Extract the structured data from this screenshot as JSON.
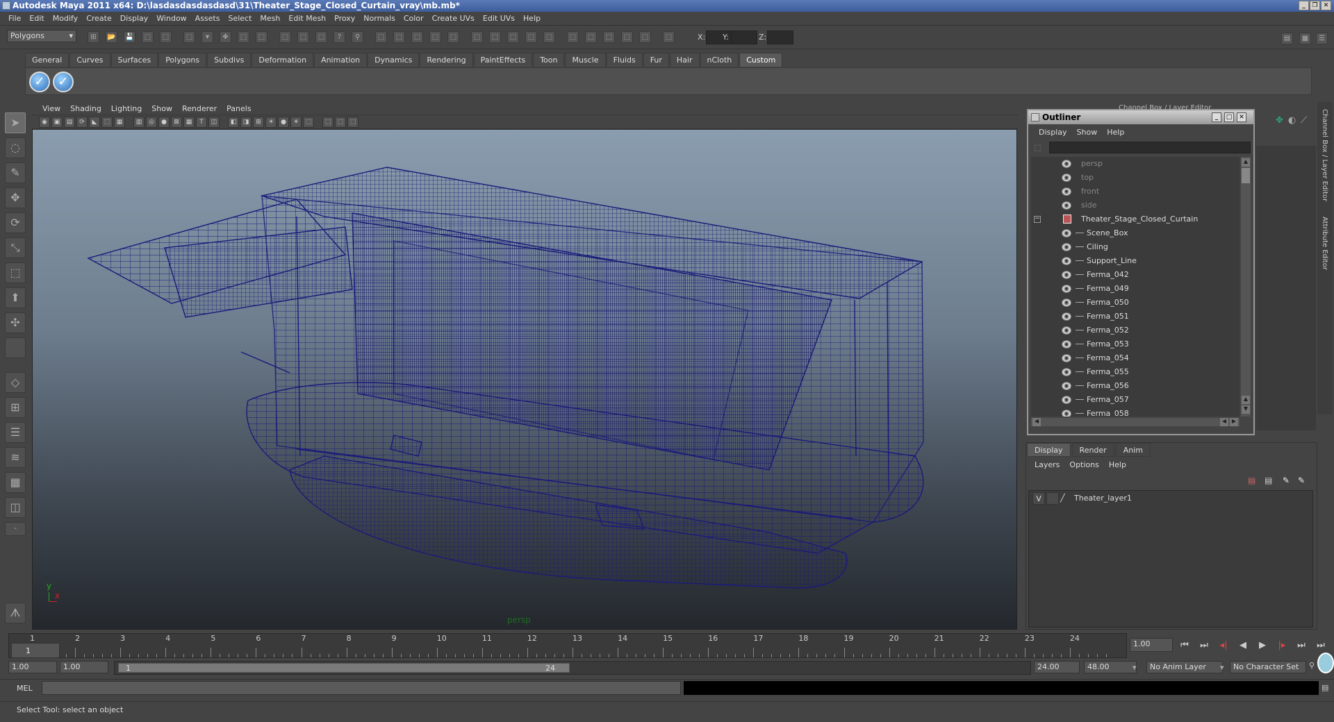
{
  "window": {
    "title": "Autodesk Maya 2011 x64: D:\\lasdasdasdasdasd\\31\\Theater_Stage_Closed_Curtain_vray\\mb.mb*"
  },
  "menubar": [
    "File",
    "Edit",
    "Modify",
    "Create",
    "Display",
    "Window",
    "Assets",
    "Select",
    "Mesh",
    "Edit Mesh",
    "Proxy",
    "Normals",
    "Color",
    "Create UVs",
    "Edit UVs",
    "Help"
  ],
  "status_line": {
    "mode": "Polygons",
    "x_label": "X:",
    "y_label": "Y:",
    "z_label": "Z:"
  },
  "shelf": {
    "tabs": [
      "General",
      "Curves",
      "Surfaces",
      "Polygons",
      "Subdivs",
      "Deformation",
      "Animation",
      "Dynamics",
      "Rendering",
      "PaintEffects",
      "Toon",
      "Muscle",
      "Fluids",
      "Fur",
      "Hair",
      "nCloth",
      "Custom"
    ],
    "active_tab": "Custom"
  },
  "viewport": {
    "menu": [
      "View",
      "Shading",
      "Lighting",
      "Show",
      "Renderer",
      "Panels"
    ],
    "camera": "persp",
    "axis_y": "y",
    "axis_x": "x",
    "wire_color": "#1a1a7a"
  },
  "outliner": {
    "title": "Outliner",
    "menu": [
      "Display",
      "Show",
      "Help"
    ],
    "cameras": [
      "persp",
      "top",
      "front",
      "side"
    ],
    "root": "Theater_Stage_Closed_Curtain",
    "children": [
      "Scene_Box",
      "Ciling",
      "Support_Line",
      "Ferma_042",
      "Ferma_049",
      "Ferma_050",
      "Ferma_051",
      "Ferma_052",
      "Ferma_053",
      "Ferma_054",
      "Ferma_055",
      "Ferma_056",
      "Ferma_057",
      "Ferma_058"
    ]
  },
  "channel_box": {
    "header": "Channel Box / Layer Editor",
    "side_tab_1": "Channel Box / Layer Editor",
    "side_tab_2": "Attribute Editor"
  },
  "layer_editor": {
    "tabs": [
      "Display",
      "Render",
      "Anim"
    ],
    "active_tab": "Display",
    "menu": [
      "Layers",
      "Options",
      "Help"
    ],
    "layer": {
      "visible": "V",
      "name": "Theater_layer1"
    }
  },
  "time_slider": {
    "ticks": [
      "1",
      "2",
      "3",
      "4",
      "5",
      "6",
      "7",
      "8",
      "9",
      "10",
      "11",
      "12",
      "13",
      "14",
      "15",
      "16",
      "17",
      "18",
      "19",
      "20",
      "21",
      "22",
      "23",
      "24"
    ],
    "current_frame": "1",
    "current_time": "1.00"
  },
  "range_slider": {
    "start": "1.00",
    "range_start": "1.00",
    "bar_start": "1",
    "bar_end": "24",
    "end": "24.00",
    "total_end": "48.00",
    "anim_layer": "No Anim Layer",
    "char_set": "No Character Set"
  },
  "command_line": {
    "label": "MEL"
  },
  "help_line": {
    "text": "Select Tool: select an object"
  }
}
